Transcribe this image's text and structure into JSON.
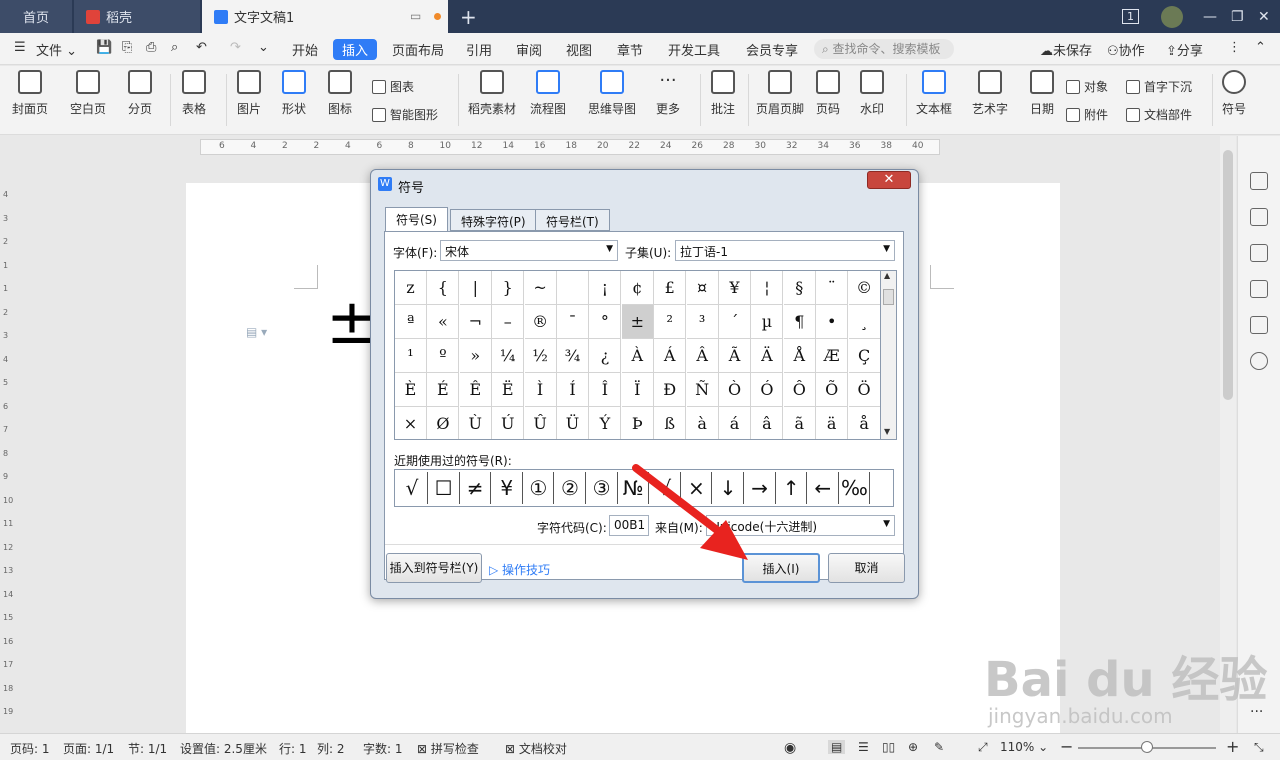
{
  "titlebar": {
    "tabs": [
      {
        "label": "首页"
      },
      {
        "label": "稻壳"
      },
      {
        "label": "文字文稿1"
      }
    ],
    "new_tab": "+",
    "window_count": "1"
  },
  "menubar": {
    "file": "文件",
    "items": [
      "开始",
      "插入",
      "页面布局",
      "引用",
      "审阅",
      "视图",
      "章节",
      "开发工具",
      "会员专享"
    ],
    "active": "插入",
    "search_placeholder": "查找命令、搜索模板",
    "right": [
      "未保存",
      "协作",
      "分享"
    ]
  },
  "ribbon": {
    "large": [
      "封面页",
      "空白页",
      "分页",
      "表格",
      "图片",
      "形状",
      "图标",
      "稻壳素材",
      "流程图",
      "思维导图",
      "更多",
      "批注",
      "页眉页脚",
      "页码",
      "水印",
      "文本框",
      "艺术字",
      "日期",
      "符号"
    ],
    "small": [
      "图表",
      "智能图形",
      "对象",
      "附件",
      "首字下沉",
      "文档部件"
    ],
    "more": "···"
  },
  "ruler": {
    "h_ticks": [
      "6",
      "4",
      "2",
      "2",
      "4",
      "6",
      "8",
      "10",
      "12",
      "14",
      "16",
      "18",
      "20",
      "22",
      "24",
      "26",
      "28",
      "30",
      "32",
      "34",
      "36",
      "38",
      "40"
    ],
    "v_ticks": [
      "4",
      "3",
      "2",
      "1",
      "1",
      "2",
      "3",
      "4",
      "5",
      "6",
      "7",
      "8",
      "9",
      "10",
      "11",
      "12",
      "13",
      "14",
      "15",
      "16",
      "17",
      "18",
      "19"
    ]
  },
  "document": {
    "symbol": "±"
  },
  "dialog": {
    "title": "符号",
    "close": "✕",
    "tabs": [
      "符号(S)",
      "特殊字符(P)",
      "符号栏(T)"
    ],
    "font_label": "字体(F):",
    "font_value": "宋体",
    "subset_label": "子集(U):",
    "subset_value": "拉丁语-1",
    "grid": [
      [
        "z",
        "{",
        "|",
        "}",
        "~",
        "",
        "¡",
        "¢",
        "£",
        "¤",
        "¥",
        "¦",
        "§",
        "¨",
        "©"
      ],
      [
        "ª",
        "«",
        "¬",
        "–",
        "®",
        "¯",
        "°",
        "±",
        "²",
        "³",
        "´",
        "µ",
        "¶",
        "•",
        "¸"
      ],
      [
        "¹",
        "º",
        "»",
        "¼",
        "½",
        "¾",
        "¿",
        "À",
        "Á",
        "Â",
        "Ã",
        "Ä",
        "Å",
        "Æ",
        "Ç"
      ],
      [
        "È",
        "É",
        "Ê",
        "Ë",
        "Ì",
        "Í",
        "Î",
        "Ï",
        "Ð",
        "Ñ",
        "Ò",
        "Ó",
        "Ô",
        "Õ",
        "Ö"
      ],
      [
        "×",
        "Ø",
        "Ù",
        "Ú",
        "Û",
        "Ü",
        "Ý",
        "Þ",
        "ß",
        "à",
        "á",
        "â",
        "ã",
        "ä",
        "å"
      ]
    ],
    "selected": "±",
    "recent_label": "近期使用过的符号(R):",
    "recent": [
      "√",
      "☐",
      "≠",
      "¥",
      "①",
      "②",
      "③",
      "№",
      "√",
      "×",
      "↓",
      "→",
      "↑",
      "←",
      "‰"
    ],
    "code_label": "字符代码(C):",
    "code_value": "00B1",
    "from_label": "来自(M):",
    "from_value": "Unicode(十六进制)",
    "add_to_bar": "插入到符号栏(Y)",
    "tips": "操作技巧",
    "insert": "插入(I)",
    "cancel": "取消"
  },
  "statusbar": {
    "items": [
      "页码: 1",
      "页面: 1/1",
      "节: 1/1",
      "设置值: 2.5厘米",
      "行: 1",
      "列: 2",
      "字数: 1",
      "拼写检查",
      "文档校对"
    ],
    "zoom": "110%",
    "minus": "−",
    "plus": "+"
  },
  "watermark": {
    "brand": "Bai du 经验",
    "url": "jingyan.baidu.com"
  },
  "colors": {
    "accent": "#2f7cf6",
    "titlebar": "#2b3a55",
    "arrow": "#e8231f"
  }
}
